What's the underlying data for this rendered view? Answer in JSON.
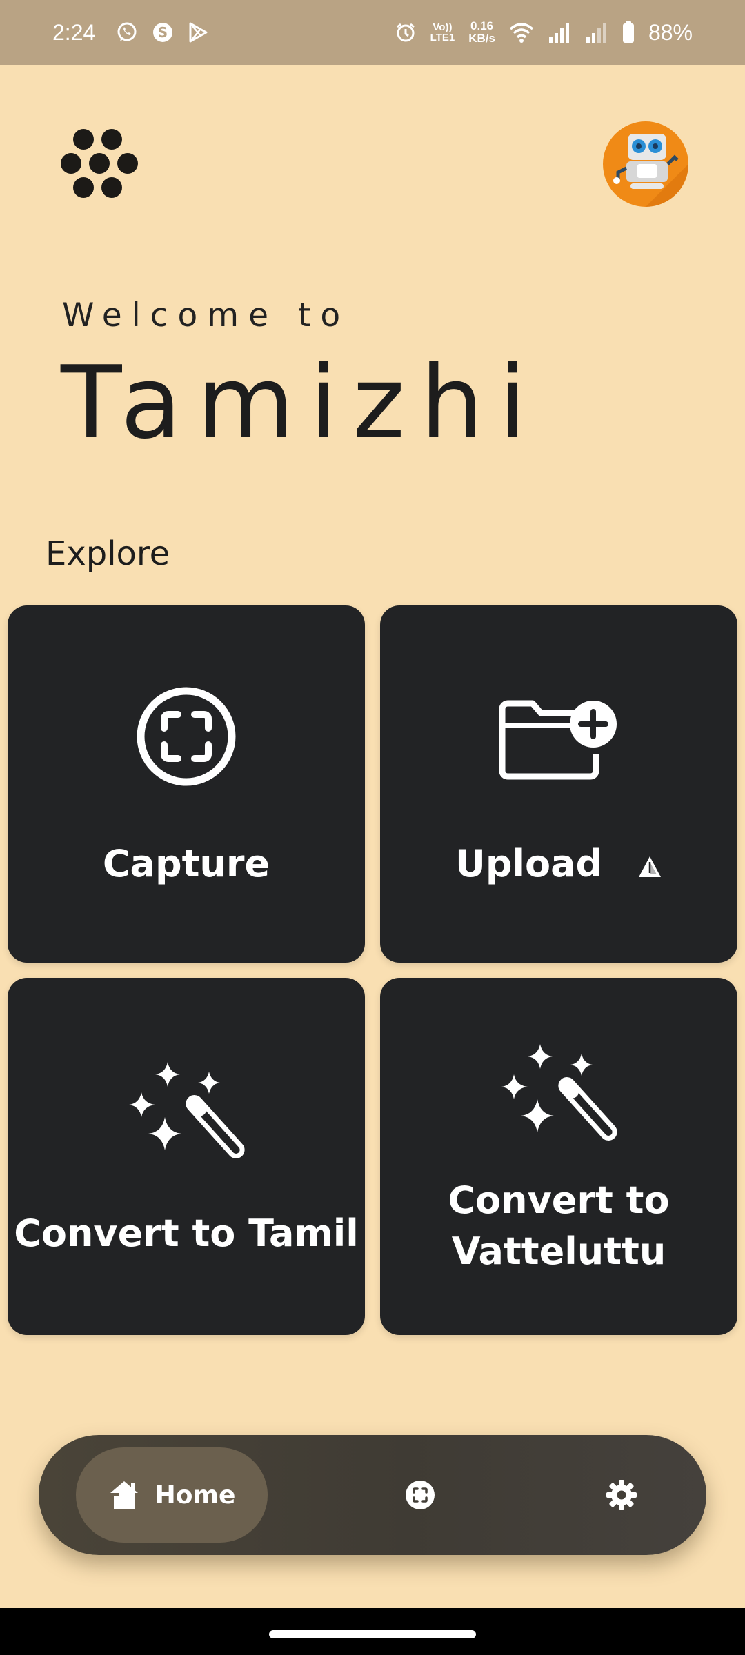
{
  "status_bar": {
    "time": "2:24",
    "volte_top": "Vo))",
    "volte_bottom": "LTE1",
    "net_speed_value": "0.16",
    "net_speed_unit": "KB/s",
    "battery": "88%",
    "icons": [
      "whatsapp-icon",
      "skype-icon",
      "play-store-icon",
      "alarm-icon",
      "wifi-icon",
      "signal-icon",
      "signal-icon",
      "battery-icon"
    ]
  },
  "header": {
    "logo_icon": "dots-logo-icon",
    "avatar_icon": "robot-avatar-icon"
  },
  "hero": {
    "welcome": "Welcome to",
    "app_name": "Tamizhi"
  },
  "explore": {
    "heading": "Explore",
    "cards": [
      {
        "label": "Capture",
        "icon": "capture-icon"
      },
      {
        "label": "Upload",
        "icon": "folder-add-icon",
        "badge_icon": "warning-icon"
      },
      {
        "label": "Convert to Tamil",
        "icon": "magic-wand-icon"
      },
      {
        "label_line1": "Convert to",
        "label_line2": "Vatteluttu",
        "icon": "magic-wand-icon"
      }
    ]
  },
  "bottom_nav": {
    "items": [
      {
        "label": "Home",
        "icon": "home-icon",
        "selected": true
      },
      {
        "icon": "scan-icon",
        "selected": false
      },
      {
        "icon": "settings-icon",
        "selected": false
      }
    ]
  },
  "colors": {
    "background": "#F9DFB2",
    "status_bar": "#B9A384",
    "card": "#222325",
    "nav_bar": "#423e37",
    "nav_selected": "#6b604e",
    "avatar": "#F08A16"
  }
}
